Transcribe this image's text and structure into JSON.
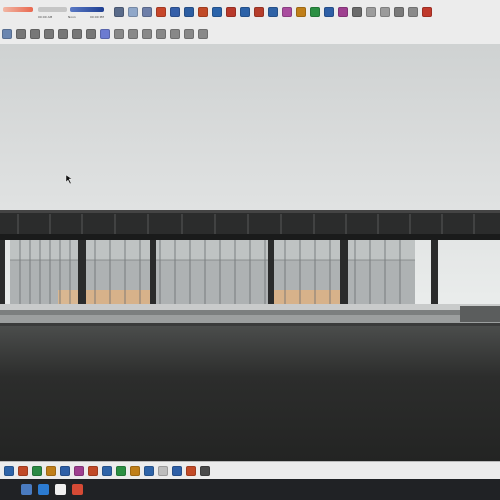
{
  "toolbar_top": {
    "time_left": "00:00 AM",
    "time_right": "00:00 PM",
    "ticks": "Noon"
  },
  "icons_row1": [
    {
      "name": "select-icon",
      "color": "#5a6b8a"
    },
    {
      "name": "eraser-icon",
      "color": "#8fa7c9"
    },
    {
      "name": "paint-icon",
      "color": "#6d7ea8"
    },
    {
      "name": "line-icon",
      "color": "#c7462a"
    },
    {
      "name": "rectangle-icon",
      "color": "#355fa9"
    },
    {
      "name": "circle-icon",
      "color": "#2c5ea2"
    },
    {
      "name": "polygon-icon",
      "color": "#c14a27"
    },
    {
      "name": "arc-icon",
      "color": "#2a63aa"
    },
    {
      "name": "pushpull-icon",
      "color": "#b8392b"
    },
    {
      "name": "move-icon",
      "color": "#2c62a8"
    },
    {
      "name": "rotate-icon",
      "color": "#b63d2b"
    },
    {
      "name": "scale-icon",
      "color": "#2f62a6"
    },
    {
      "name": "offset-icon",
      "color": "#a94c9e"
    },
    {
      "name": "tape-icon",
      "color": "#c07f19"
    },
    {
      "name": "paint-bucket-icon",
      "color": "#2b8f42"
    },
    {
      "name": "orbit-icon",
      "color": "#2e5fa6"
    },
    {
      "name": "pan-icon",
      "color": "#9e3f8f"
    },
    {
      "name": "zoom-icon",
      "color": "#6b6b6b"
    },
    {
      "name": "warehouse-icon",
      "color": "#9c9c9c"
    },
    {
      "name": "extension-icon",
      "color": "#9b9b9b"
    },
    {
      "name": "layout-icon",
      "color": "#7a7a7a"
    },
    {
      "name": "style-icon",
      "color": "#8a8a8a"
    },
    {
      "name": "export-icon",
      "color": "#c0392b"
    }
  ],
  "icons_row2": [
    {
      "name": "camera-icon",
      "color": "#6b86b0"
    },
    {
      "name": "iso-view-icon",
      "color": "#777"
    },
    {
      "name": "top-view-icon",
      "color": "#777"
    },
    {
      "name": "front-view-icon",
      "color": "#777"
    },
    {
      "name": "right-view-icon",
      "color": "#777"
    },
    {
      "name": "back-view-icon",
      "color": "#777"
    },
    {
      "name": "left-view-icon",
      "color": "#777"
    },
    {
      "name": "xray-icon",
      "color": "#6c7bd1"
    },
    {
      "name": "wireframe-icon",
      "color": "#888"
    },
    {
      "name": "hidden-line-icon",
      "color": "#888"
    },
    {
      "name": "shaded-icon",
      "color": "#888"
    },
    {
      "name": "textured-icon",
      "color": "#888"
    },
    {
      "name": "monochrome-icon",
      "color": "#888"
    },
    {
      "name": "section-icon",
      "color": "#888"
    },
    {
      "name": "section-display-icon",
      "color": "#888"
    }
  ],
  "bottom_icons": [
    {
      "name": "followme-icon",
      "color": "#2f64a8"
    },
    {
      "name": "text-icon",
      "color": "#c14a27"
    },
    {
      "name": "axes-icon",
      "color": "#2c8a44"
    },
    {
      "name": "dimension-icon",
      "color": "#c07f19"
    },
    {
      "name": "protractor-icon",
      "color": "#2e5fa6"
    },
    {
      "name": "3dtext-icon",
      "color": "#9e3f8f"
    },
    {
      "name": "walk-icon",
      "color": "#c14a27"
    },
    {
      "name": "look-around-icon",
      "color": "#2f64a8"
    },
    {
      "name": "position-camera-icon",
      "color": "#2b8f42"
    },
    {
      "name": "sandbox-icon",
      "color": "#c07f19"
    },
    {
      "name": "shadow-icon",
      "color": "#2f64a8"
    },
    {
      "name": "fog-icon",
      "color": "#bdbdbd"
    },
    {
      "name": "match-photo-icon",
      "color": "#2e5fa6"
    },
    {
      "name": "solid-tools-icon",
      "color": "#c14a27"
    },
    {
      "name": "outliner-icon",
      "color": "#4a4a4a"
    }
  ],
  "taskbar": {
    "apps": [
      {
        "name": "file-explorer-taskbar-icon",
        "color": "#4a7bc0"
      },
      {
        "name": "browser-taskbar-icon",
        "color": "#2c7bd1"
      },
      {
        "name": "document-taskbar-icon",
        "color": "#efefef"
      },
      {
        "name": "sketchup-taskbar-icon",
        "color": "#d54a35"
      }
    ]
  }
}
